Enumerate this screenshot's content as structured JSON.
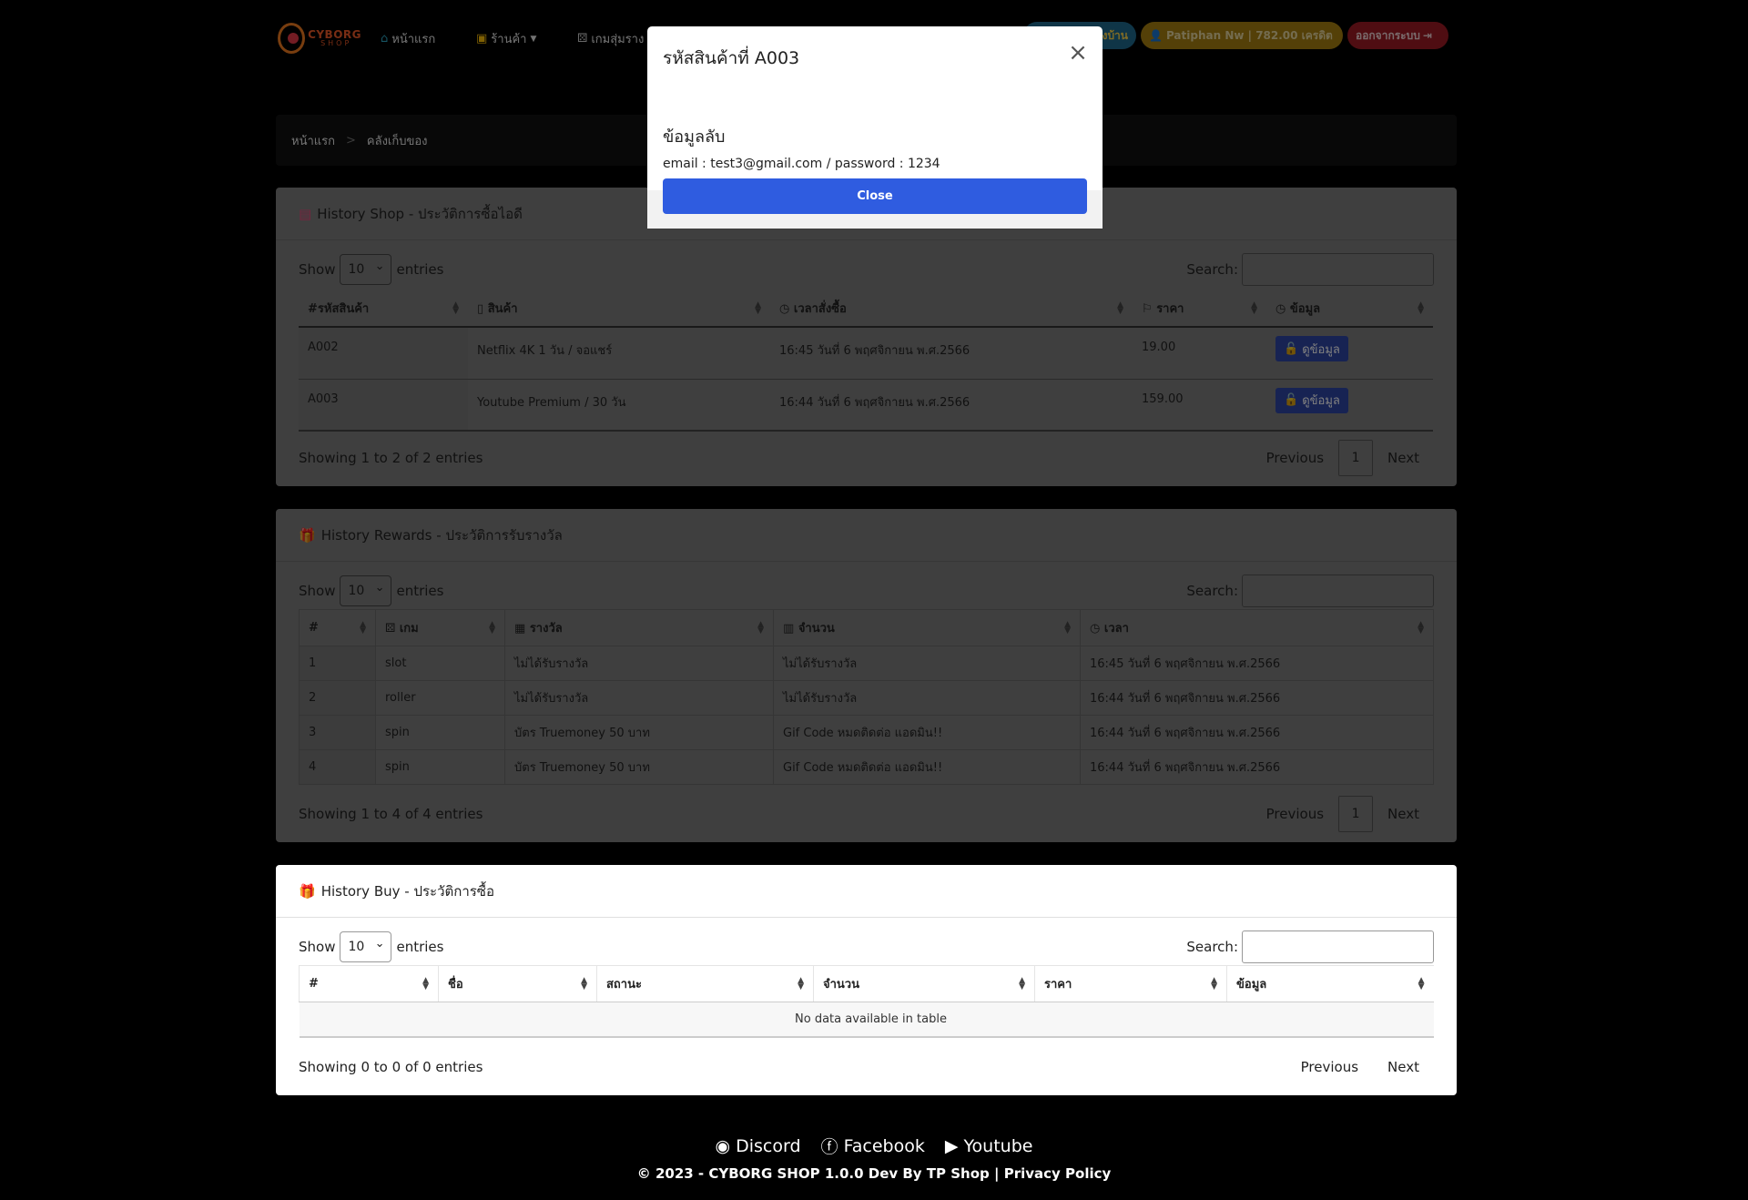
{
  "colors": {
    "primary": "#2f5ce0",
    "danger": "#9e1b24",
    "warning": "#a98010",
    "info": "#1f6b8e",
    "view_button": "#2f46a6"
  },
  "navbar": {
    "logo_line1": "CYBORG",
    "logo_line2": "SHOP",
    "home": "หน้าแรก",
    "shop": "ร้านค้า",
    "game": "เกมสุ่มราง",
    "pill_blue": "งบ้าน",
    "user_pill": "Patiphan Nw | 782.00 เครดิต",
    "logout": "ออกจากระบบ"
  },
  "breadcrumb": {
    "home": "หน้าแรก",
    "current": "คลังเก็บของ"
  },
  "history_shop": {
    "title": "History Shop - ประวัติการซื้อไอดี",
    "show": "Show",
    "entries": "entries",
    "length": "10",
    "search": "Search:",
    "columns": [
      "#รหัสสินค้า",
      "สินค้า",
      "เวลาสั่งซื้อ",
      "ราคา",
      "ข้อมูล"
    ],
    "rows": [
      {
        "code": "A002",
        "product": "Netflix 4K 1 วัน / จอแชร์",
        "time": "16:45 วันที่ 6 พฤศจิกายน พ.ศ.2566",
        "price": "19.00",
        "action": "ดูข้อมูล"
      },
      {
        "code": "A003",
        "product": "Youtube Premium / 30 วัน",
        "time": "16:44 วันที่ 6 พฤศจิกายน พ.ศ.2566",
        "price": "159.00",
        "action": "ดูข้อมูล"
      }
    ],
    "info": "Showing 1 to 2 of 2 entries",
    "prev": "Previous",
    "page": "1",
    "next": "Next"
  },
  "history_rewards": {
    "title": "History Rewards - ประวัติการรับรางวัล",
    "show": "Show",
    "entries": "entries",
    "length": "10",
    "search": "Search:",
    "columns": [
      "#",
      "เกม",
      "รางวัล",
      "จำนวน",
      "เวลา"
    ],
    "rows": [
      {
        "no": "1",
        "game": "slot",
        "reward": "ไม่ได้รับรางวัล",
        "amount": "ไม่ได้รับรางวัล",
        "time": "16:45 วันที่ 6 พฤศจิกายน พ.ศ.2566"
      },
      {
        "no": "2",
        "game": "roller",
        "reward": "ไม่ได้รับรางวัล",
        "amount": "ไม่ได้รับรางวัล",
        "time": "16:44 วันที่ 6 พฤศจิกายน พ.ศ.2566"
      },
      {
        "no": "3",
        "game": "spin",
        "reward": "บัตร Truemoney 50 บาท",
        "amount": "Gif Code หมดติดต่อ แอดมิน!!",
        "time": "16:44 วันที่ 6 พฤศจิกายน พ.ศ.2566"
      },
      {
        "no": "4",
        "game": "spin",
        "reward": "บัตร Truemoney 50 บาท",
        "amount": "Gif Code หมดติดต่อ แอดมิน!!",
        "time": "16:44 วันที่ 6 พฤศจิกายน พ.ศ.2566"
      }
    ],
    "info": "Showing 1 to 4 of 4 entries",
    "prev": "Previous",
    "page": "1",
    "next": "Next"
  },
  "history_buy": {
    "title": "History Buy - ประวัติการซื้อ",
    "show": "Show",
    "entries": "entries",
    "length": "10",
    "search": "Search:",
    "columns": [
      "#",
      "ชื่อ",
      "สถานะ",
      "จำนวน",
      "ราคา",
      "ข้อมูล"
    ],
    "empty": "No data available in table",
    "info": "Showing 0 to 0 of 0 entries",
    "prev": "Previous",
    "next": "Next"
  },
  "modal": {
    "title": "รหัสสินค้าที่ A003",
    "heading": "ข้อมูลลับ",
    "text": "email : test3@gmail.com / password : 1234",
    "close_label": "Close",
    "x_icon": "close-icon"
  },
  "footer": {
    "discord": "Discord",
    "facebook": "Facebook",
    "youtube": "Youtube",
    "copyright": "© 2023 - CYBORG SHOP 1.0.0 Dev By TP Shop | Privacy Policy"
  }
}
